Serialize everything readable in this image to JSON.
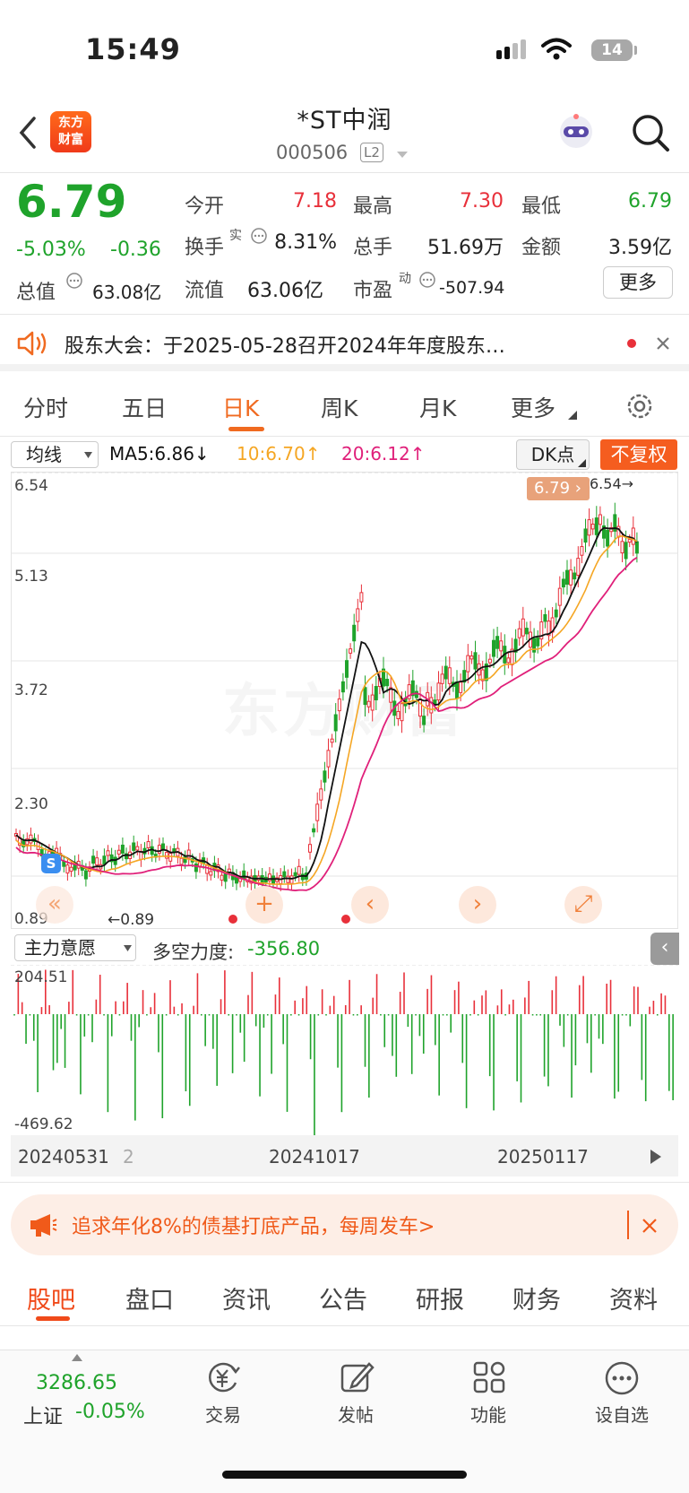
{
  "status": {
    "time": "15:49",
    "battery": "14"
  },
  "header": {
    "logo": "东方\n财富",
    "title": "*ST中润",
    "code": "000506",
    "level": "L2"
  },
  "quote": {
    "price": "6.79",
    "change_pct": "-5.03%",
    "change": "-0.36",
    "open_label": "今开",
    "open": "7.18",
    "high_label": "最高",
    "high": "7.30",
    "low_label": "最低",
    "low": "6.79",
    "turnover_label": "换手",
    "turnover_sup": "实",
    "turnover": "8.31%",
    "volume_label": "总手",
    "volume": "51.69万",
    "amount_label": "金额",
    "amount": "3.59亿",
    "mcap_label": "总值",
    "mcap": "63.08亿",
    "float_label": "流值",
    "float": "63.06亿",
    "pe_label": "市盈",
    "pe_sup": "动",
    "pe": "-507.94",
    "more": "更多"
  },
  "notice": {
    "label": "股东大会：",
    "text": "于2025-05-28召开2024年年度股东…"
  },
  "tabs": [
    "分时",
    "五日",
    "日K",
    "周K",
    "月K",
    "更多"
  ],
  "ma_bar": {
    "select": "均线",
    "ma5": "MA5:6.86↓",
    "ma10": "10:6.70↑",
    "ma20": "20:6.12↑",
    "dk": "DK点",
    "fq": "不复权"
  },
  "price_axis": [
    "6.54",
    "5.13",
    "3.72",
    "2.30",
    "0.89"
  ],
  "price_tags": {
    "current": "6.79",
    "high_mark": "6.54",
    "low_mark": "0.89",
    "s_badge": "S"
  },
  "indicator": {
    "select": "主力意愿",
    "label": "多空力度:",
    "value": "-356.80",
    "max": "204.51",
    "min": "-469.62"
  },
  "dates": {
    "d1": "20240531",
    "d1b": "2",
    "d2": "20241017",
    "d3": "20250117"
  },
  "ad": {
    "text": "追求年化8%的债基打底产品，每周发车>"
  },
  "sub_tabs": [
    "股吧",
    "盘口",
    "资讯",
    "公告",
    "研报",
    "财务",
    "资料"
  ],
  "bottom_nav": {
    "index_value": "3286.65",
    "index_label": "上证",
    "index_change": "-0.05%",
    "trade": "交易",
    "post": "发帖",
    "func": "功能",
    "fav": "设自选"
  },
  "watermark": "东方财富",
  "colors": {
    "up": "#e8303a",
    "down": "#1fa32b",
    "accent": "#f06a20",
    "ma5": "#111111",
    "ma10": "#f5a623",
    "ma20": "#e0207a"
  }
}
